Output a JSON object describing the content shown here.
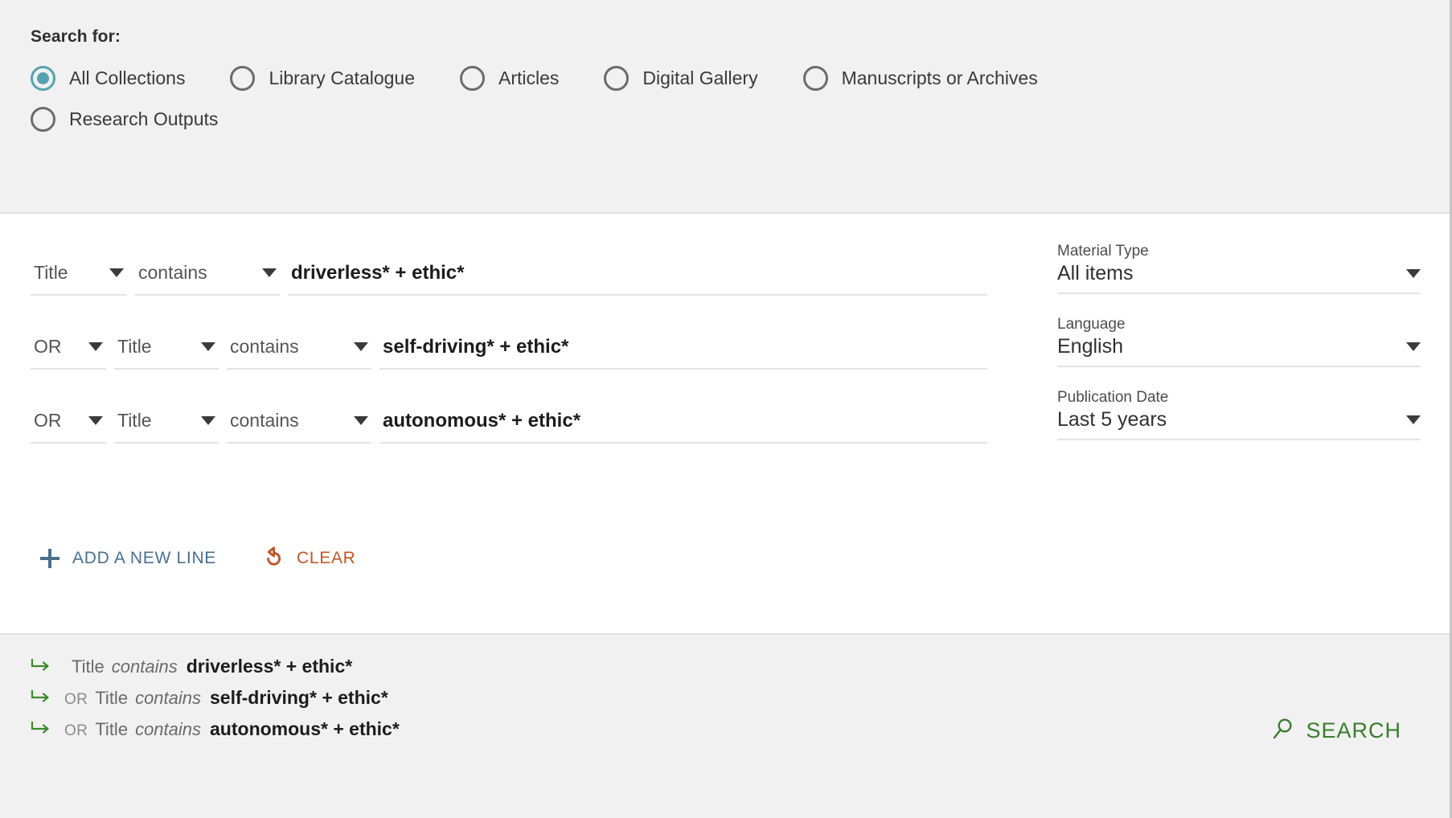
{
  "scope": {
    "label": "Search for:",
    "options": [
      {
        "label": "All Collections",
        "selected": true
      },
      {
        "label": "Library Catalogue",
        "selected": false
      },
      {
        "label": "Articles",
        "selected": false
      },
      {
        "label": "Digital Gallery",
        "selected": false
      },
      {
        "label": "Manuscripts or Archives",
        "selected": false
      },
      {
        "label": "Research Outputs",
        "selected": false
      }
    ]
  },
  "criteria": [
    {
      "boolean": "",
      "index": "Title",
      "precision": "contains",
      "term": "driverless* +  ethic*"
    },
    {
      "boolean": "OR",
      "index": "Title",
      "precision": "contains",
      "term": "self-driving* + ethic*"
    },
    {
      "boolean": "OR",
      "index": "Title",
      "precision": "contains",
      "term": "autonomous* + ethic*"
    }
  ],
  "facets": [
    {
      "label": "Material Type",
      "value": "All items"
    },
    {
      "label": "Language",
      "value": "English"
    },
    {
      "label": "Publication Date",
      "value": "Last 5 years"
    }
  ],
  "actions": {
    "add_line": "ADD A NEW LINE",
    "clear": "CLEAR"
  },
  "summary": {
    "lines": [
      {
        "boolean": "",
        "index": "Title",
        "precision": "contains",
        "term": "driverless* +  ethic*"
      },
      {
        "boolean": "OR",
        "index": "Title",
        "precision": "contains",
        "term": "self-driving* + ethic*"
      },
      {
        "boolean": "OR",
        "index": "Title",
        "precision": "contains",
        "term": "autonomous* + ethic*"
      }
    ],
    "search_button": "SEARCH"
  },
  "colors": {
    "radio_selected": "#55a2ae",
    "add_line": "#4a6f8e",
    "clear": "#c0562a",
    "search": "#3a7d2c",
    "arrow": "#3d8b2e",
    "panel_background": "#f1f1f1"
  }
}
